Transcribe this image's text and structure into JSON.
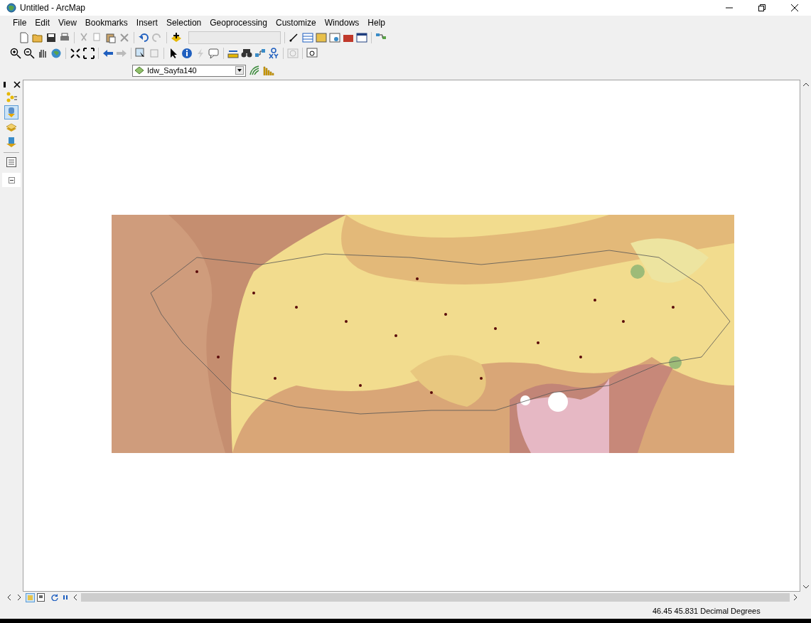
{
  "window": {
    "title": "Untitled - ArcMap"
  },
  "menu": [
    "File",
    "Edit",
    "View",
    "Bookmarks",
    "Insert",
    "Selection",
    "Geoprocessing",
    "Customize",
    "Windows",
    "Help"
  ],
  "layer_dropdown": {
    "value": "Idw_Sayfa140"
  },
  "status_bar": {
    "coordinates": "46.45  45.831 Decimal Degrees"
  }
}
